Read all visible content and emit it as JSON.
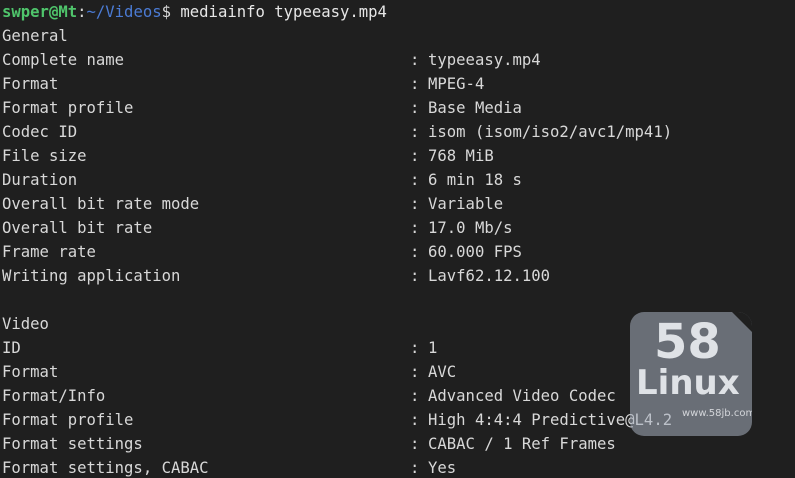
{
  "prompt": {
    "user_host": "swper@Mt",
    "colon": ":",
    "path": "~/Videos",
    "symbol": "$ ",
    "command": "mediainfo typeeasy.mp4"
  },
  "separator": ": ",
  "general": {
    "title": "General",
    "rows": [
      {
        "label": "Complete name",
        "value": "typeeasy.mp4"
      },
      {
        "label": "Format",
        "value": "MPEG-4"
      },
      {
        "label": "Format profile",
        "value": "Base Media"
      },
      {
        "label": "Codec ID",
        "value": "isom (isom/iso2/avc1/mp41)"
      },
      {
        "label": "File size",
        "value": "768 MiB"
      },
      {
        "label": "Duration",
        "value": "6 min 18 s"
      },
      {
        "label": "Overall bit rate mode",
        "value": "Variable"
      },
      {
        "label": "Overall bit rate",
        "value": "17.0 Mb/s"
      },
      {
        "label": "Frame rate",
        "value": "60.000 FPS"
      },
      {
        "label": "Writing application",
        "value": "Lavf62.12.100"
      }
    ]
  },
  "video": {
    "title": "Video",
    "rows": [
      {
        "label": "ID",
        "value": "1"
      },
      {
        "label": "Format",
        "value": "AVC"
      },
      {
        "label": "Format/Info",
        "value": "Advanced Video Codec"
      },
      {
        "label": "Format profile",
        "value": "High 4:4:4 Predictive@L4.2"
      },
      {
        "label": "Format settings",
        "value": "CABAC / 1 Ref Frames"
      },
      {
        "label": "Format settings, CABAC",
        "value": "Yes"
      }
    ]
  },
  "watermark": {
    "number": "58",
    "brand": "Linux",
    "url": "www.58jb.com"
  },
  "colors": {
    "background": "#1f1f1f",
    "text": "#d8d8d8",
    "prompt_user": "#4fc46b",
    "prompt_path": "#4b7bd4"
  }
}
